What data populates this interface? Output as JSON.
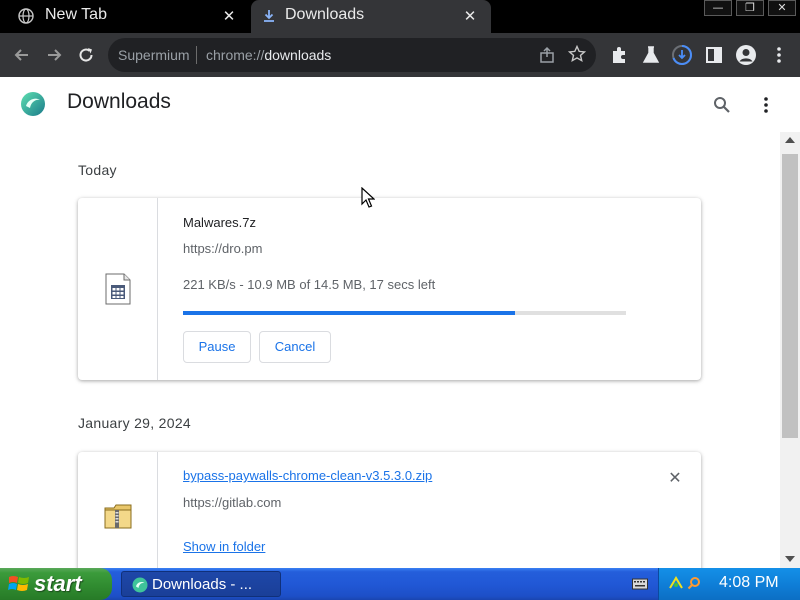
{
  "tabs": [
    {
      "label": "New Tab",
      "icon": "globe-icon"
    },
    {
      "label": "Downloads",
      "icon": "download-icon",
      "active": true
    }
  ],
  "toolbar": {
    "site_name": "Supermium",
    "url_prefix": "chrome://",
    "url_host": "downloads"
  },
  "header": {
    "title": "Downloads"
  },
  "groups": [
    {
      "date": "Today",
      "item": {
        "name": "Malwares.7z",
        "url": "https://dro.pm",
        "status": "221 KB/s - 10.9 MB of 14.5 MB, 17 secs left",
        "progress": 0.75,
        "pause_label": "Pause",
        "cancel_label": "Cancel"
      }
    },
    {
      "date": "January 29, 2024",
      "item": {
        "name": "bypass-paywalls-chrome-clean-v3.5.3.0.zip",
        "url": "https://gitlab.com",
        "show_folder_label": "Show in folder",
        "remove_label": "✕"
      }
    }
  ],
  "taskbar": {
    "start_label": "start",
    "task_label": "Downloads - ...",
    "clock": "4:08 PM"
  },
  "colors": {
    "accent": "#1a73e8",
    "tab_strip": "#000000",
    "toolbar": "#343538",
    "taskbar": "#245edb",
    "start_green": "#3b9b3b"
  }
}
